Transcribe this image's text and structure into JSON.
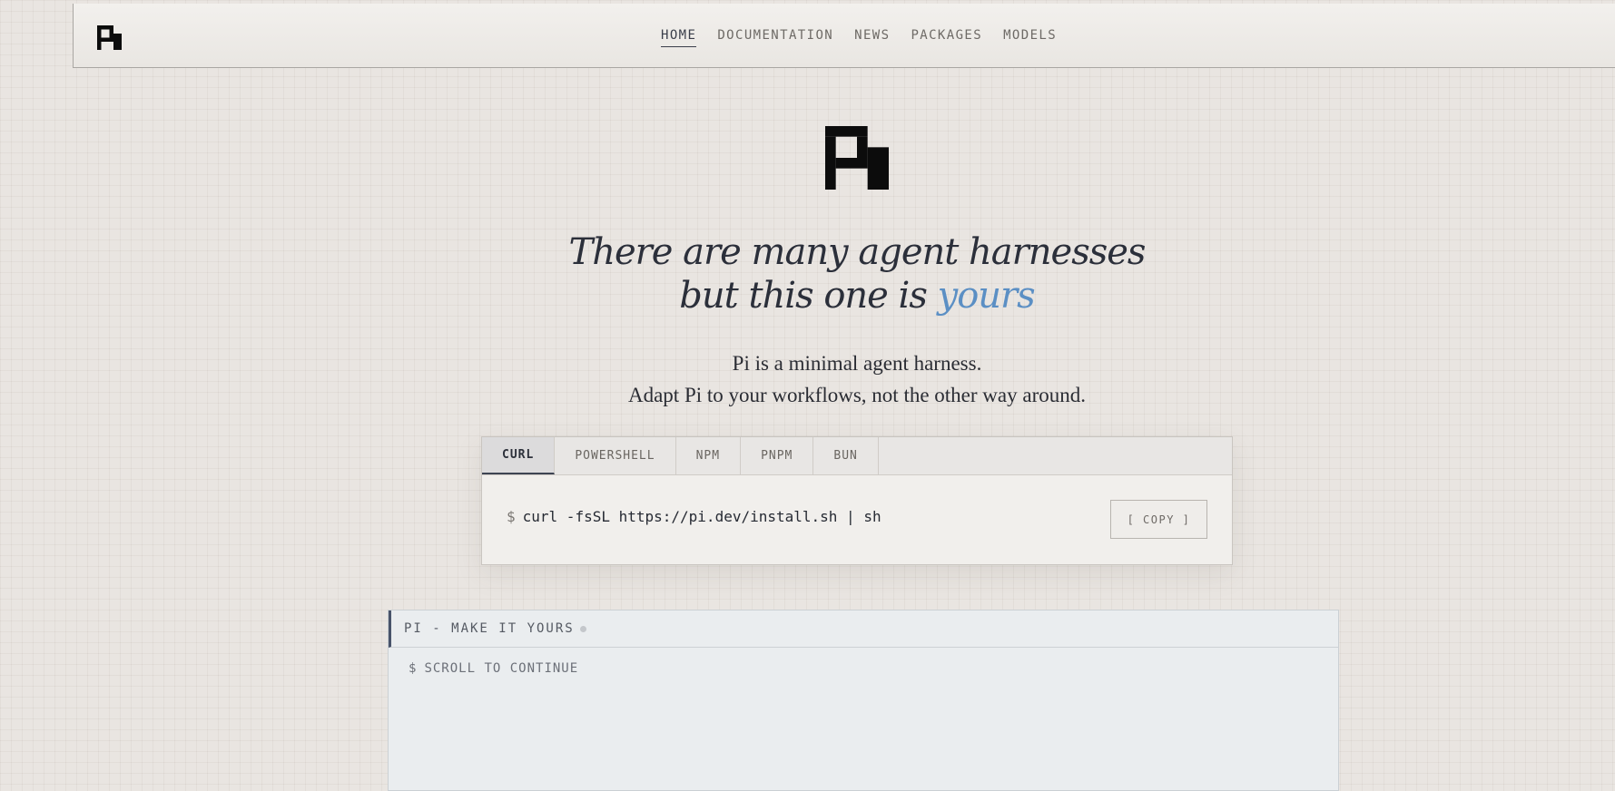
{
  "nav": {
    "logo_icon": "pi-logo-icon",
    "links": [
      {
        "label": "HOME",
        "active": true
      },
      {
        "label": "DOCUMENTATION",
        "active": false
      },
      {
        "label": "NEWS",
        "active": false
      },
      {
        "label": "PACKAGES",
        "active": false
      },
      {
        "label": "MODELS",
        "active": false
      }
    ]
  },
  "hero": {
    "logo_icon": "pi-logo-icon",
    "headline_line1": "There are many agent harnesses",
    "headline_line2_prefix": "but this one is ",
    "headline_accent": "yours",
    "accent_color": "#5b8fc4",
    "tagline_line1": "Pi is a minimal agent harness.",
    "tagline_line2": "Adapt Pi to your workflows, not the other way around."
  },
  "install": {
    "tabs": [
      {
        "label": "CURL",
        "active": true
      },
      {
        "label": "POWERSHELL",
        "active": false
      },
      {
        "label": "NPM",
        "active": false
      },
      {
        "label": "PNPM",
        "active": false
      },
      {
        "label": "BUN",
        "active": false
      }
    ],
    "prompt": "$",
    "command": "curl -fsSL https://pi.dev/install.sh | sh",
    "copy_label": "[ COPY ]"
  },
  "terminal": {
    "title": "PI - MAKE IT YOURS",
    "prompt": "$",
    "body_text": "SCROLL TO CONTINUE"
  }
}
